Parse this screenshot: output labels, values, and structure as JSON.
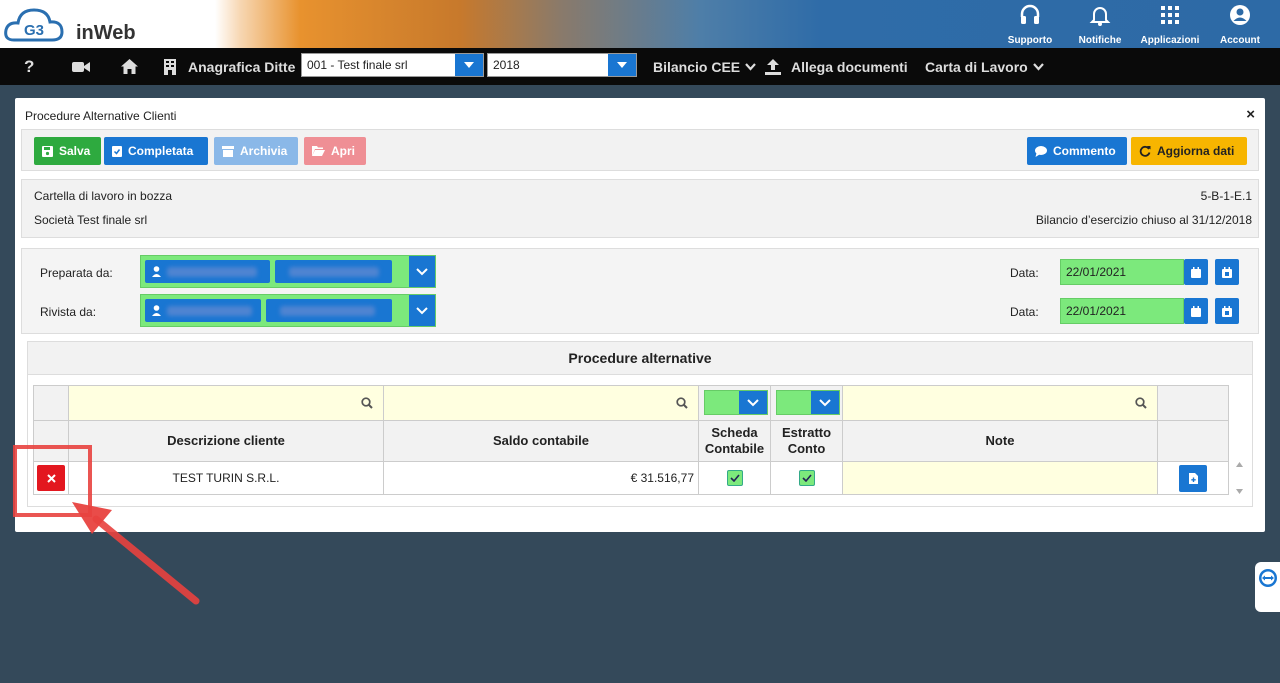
{
  "brand": {
    "logo_text": "inWeb",
    "logo_badge": "G3"
  },
  "top_icons": [
    {
      "label": "Supporto",
      "icon": "headset-icon"
    },
    {
      "label": "Notifiche",
      "icon": "bell-icon"
    },
    {
      "label": "Applicazioni",
      "icon": "grid-icon"
    },
    {
      "label": "Account",
      "icon": "user-circle-icon"
    }
  ],
  "nav": {
    "help": "?",
    "anagrafica": "Anagrafica Ditte",
    "company_value": "001 - Test finale srl",
    "year_value": "2018",
    "bilancio": "Bilancio CEE",
    "allega": "Allega documenti",
    "carta": "Carta di Lavoro"
  },
  "panel": {
    "title": "Procedure Alternative Clienti",
    "close": "×"
  },
  "toolbar": {
    "salva": "Salva",
    "completata": "Completata",
    "archivia": "Archivia",
    "apri": "Apri",
    "commento": "Commento",
    "aggiorna": "Aggiorna dati"
  },
  "info": {
    "status": "Cartella di lavoro in bozza",
    "code": "5-B-1-E.1",
    "company": "Società Test finale srl",
    "period": "Bilancio d’esercizio chiuso al 31/12/2018"
  },
  "signoff": {
    "preparata_label": "Preparata da:",
    "rivista_label": "Rivista da:",
    "data_label": "Data:",
    "preparata_date": "22/01/2021",
    "rivista_date": "22/01/2021"
  },
  "grid": {
    "section_title": "Procedure alternative",
    "columns": [
      "Descrizione cliente",
      "Saldo contabile",
      "Scheda Contabile",
      "Estratto Conto",
      "Note"
    ],
    "rows": [
      {
        "descrizione": "TEST TURIN S.R.L.",
        "saldo": "€ 31.516,77",
        "scheda": true,
        "estratto": true,
        "note": ""
      }
    ]
  },
  "colors": {
    "primary": "#1976d2",
    "success": "#2eaa3f",
    "warning": "#f7b500",
    "danger": "#e3171f",
    "field_green": "#7ce97c",
    "filter_yellow": "#ffffe0",
    "annotation": "#e8423f"
  }
}
